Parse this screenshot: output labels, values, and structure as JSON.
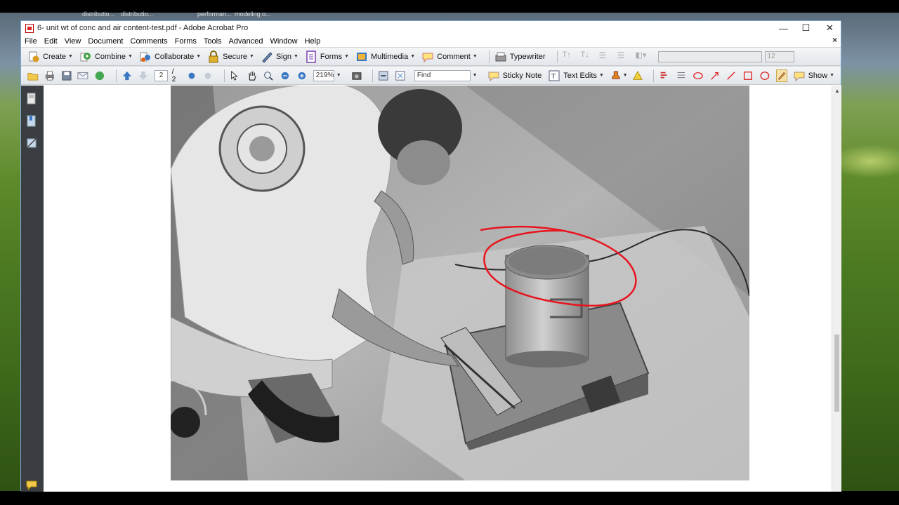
{
  "taskbar": {
    "items": [
      "distributio...",
      "distributio...",
      "performan...",
      "modeling o..."
    ]
  },
  "window": {
    "title": "6- unit wt of conc and air content-test.pdf - Adobe Acrobat Pro",
    "minimize": "—",
    "maximize": "☐",
    "close": "✕",
    "doc_close": "×"
  },
  "menu": [
    "File",
    "Edit",
    "View",
    "Document",
    "Comments",
    "Forms",
    "Tools",
    "Advanced",
    "Window",
    "Help"
  ],
  "toolbar1": {
    "create": "Create",
    "combine": "Combine",
    "collaborate": "Collaborate",
    "secure": "Secure",
    "sign": "Sign",
    "forms": "Forms",
    "multimedia": "Multimedia",
    "comment": "Comment",
    "typewriter": "Typewriter",
    "font_size": "12"
  },
  "toolbar2": {
    "page_current": "2",
    "page_total": "/ 2",
    "zoom": "219%",
    "find_placeholder": "Find",
    "sticky_note": "Sticky Note",
    "text_edits": "Text Edits",
    "show": "Show"
  },
  "colors": {
    "accent_blue": "#3b78c4",
    "annotation_red": "#e8141e",
    "nav_dark": "#3a3d42"
  }
}
